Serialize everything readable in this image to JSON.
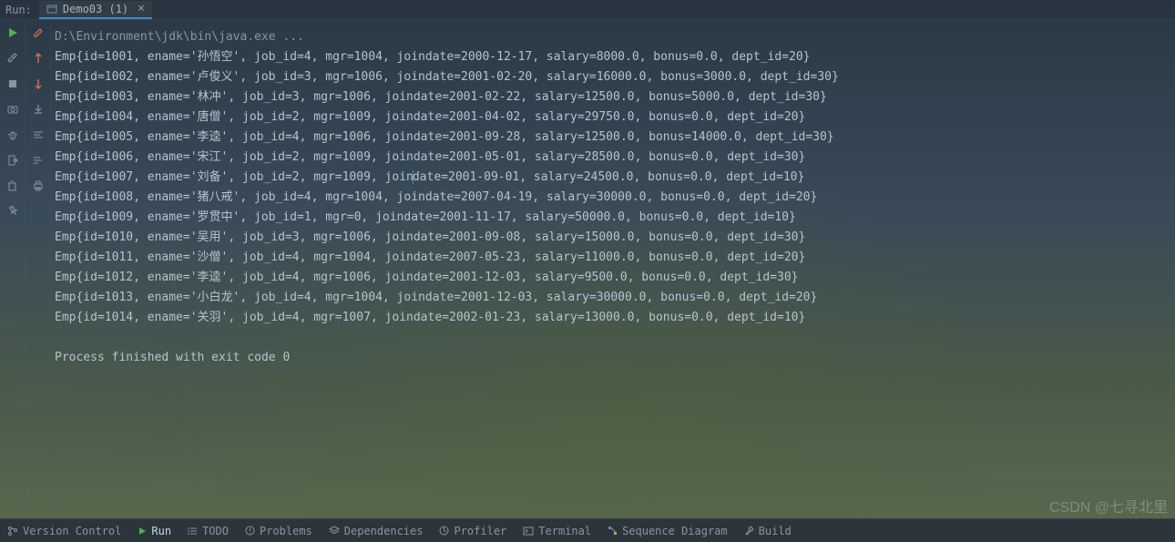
{
  "topbar": {
    "run_label": "Run:",
    "tab_name": "Demo03 (1)"
  },
  "console": {
    "command": "D:\\Environment\\jdk\\bin\\java.exe ...",
    "records": [
      {
        "id": 1001,
        "ename": "孙悟空",
        "job_id": 4,
        "mgr": 1004,
        "joindate": "2000-12-17",
        "salary": "8000.0",
        "bonus": "0.0",
        "dept_id": 20
      },
      {
        "id": 1002,
        "ename": "卢俊义",
        "job_id": 3,
        "mgr": 1006,
        "joindate": "2001-02-20",
        "salary": "16000.0",
        "bonus": "3000.0",
        "dept_id": 30
      },
      {
        "id": 1003,
        "ename": "林冲",
        "job_id": 3,
        "mgr": 1006,
        "joindate": "2001-02-22",
        "salary": "12500.0",
        "bonus": "5000.0",
        "dept_id": 30
      },
      {
        "id": 1004,
        "ename": "唐僧",
        "job_id": 2,
        "mgr": 1009,
        "joindate": "2001-04-02",
        "salary": "29750.0",
        "bonus": "0.0",
        "dept_id": 20
      },
      {
        "id": 1005,
        "ename": "李逵",
        "job_id": 4,
        "mgr": 1006,
        "joindate": "2001-09-28",
        "salary": "12500.0",
        "bonus": "14000.0",
        "dept_id": 30
      },
      {
        "id": 1006,
        "ename": "宋江",
        "job_id": 2,
        "mgr": 1009,
        "joindate": "2001-05-01",
        "salary": "28500.0",
        "bonus": "0.0",
        "dept_id": 30
      },
      {
        "id": 1007,
        "ename": "刘备",
        "job_id": 2,
        "mgr": 1009,
        "joindate": "2001-09-01",
        "salary": "24500.0",
        "bonus": "0.0",
        "dept_id": 10
      },
      {
        "id": 1008,
        "ename": "猪八戒",
        "job_id": 4,
        "mgr": 1004,
        "joindate": "2007-04-19",
        "salary": "30000.0",
        "bonus": "0.0",
        "dept_id": 20
      },
      {
        "id": 1009,
        "ename": "罗贯中",
        "job_id": 1,
        "mgr": 0,
        "joindate": "2001-11-17",
        "salary": "50000.0",
        "bonus": "0.0",
        "dept_id": 10
      },
      {
        "id": 1010,
        "ename": "吴用",
        "job_id": 3,
        "mgr": 1006,
        "joindate": "2001-09-08",
        "salary": "15000.0",
        "bonus": "0.0",
        "dept_id": 30
      },
      {
        "id": 1011,
        "ename": "沙僧",
        "job_id": 4,
        "mgr": 1004,
        "joindate": "2007-05-23",
        "salary": "11000.0",
        "bonus": "0.0",
        "dept_id": 20
      },
      {
        "id": 1012,
        "ename": "李逵",
        "job_id": 4,
        "mgr": 1006,
        "joindate": "2001-12-03",
        "salary": "9500.0",
        "bonus": "0.0",
        "dept_id": 30
      },
      {
        "id": 1013,
        "ename": "小白龙",
        "job_id": 4,
        "mgr": 1004,
        "joindate": "2001-12-03",
        "salary": "30000.0",
        "bonus": "0.0",
        "dept_id": 20
      },
      {
        "id": 1014,
        "ename": "关羽",
        "job_id": 4,
        "mgr": 1007,
        "joindate": "2002-01-23",
        "salary": "13000.0",
        "bonus": "0.0",
        "dept_id": 10
      }
    ],
    "exit_message": "Process finished with exit code 0"
  },
  "bottombar": {
    "version_control": "Version Control",
    "run": "Run",
    "todo": "TODO",
    "problems": "Problems",
    "dependencies": "Dependencies",
    "profiler": "Profiler",
    "terminal": "Terminal",
    "sequence_diagram": "Sequence Diagram",
    "build": "Build"
  },
  "watermark": "CSDN @七寻北里"
}
